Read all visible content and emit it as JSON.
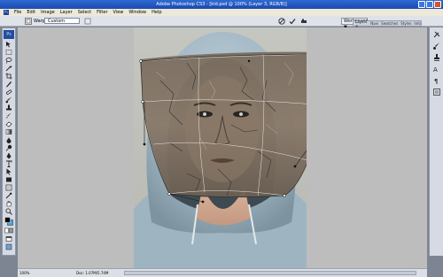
{
  "window": {
    "title": "Adobe Photoshop CS3 - [kid.psd @ 100% (Layer 3, RGB/8)]"
  },
  "menubar": {
    "logo": "Ps",
    "items": [
      "File",
      "Edit",
      "Image",
      "Layer",
      "Select",
      "Filter",
      "View",
      "Window",
      "Help"
    ]
  },
  "options": {
    "warp_label": "Warp:",
    "warp_value": "Custom",
    "workspace_label": "Workspace ▼"
  },
  "panels": {
    "tabs": [
      "Layers ×",
      "Navi",
      "Swatches",
      "Styles",
      "Info"
    ]
  },
  "toolbox": {
    "logo": "Ps"
  },
  "status": {
    "zoom": "100%",
    "doc_size": "Doc: 1.07M/5.74M"
  },
  "colors": {
    "title_bar": "#1c49b0",
    "canvas_bg": "#bdbdbd",
    "hood": "#a9bdc9"
  }
}
